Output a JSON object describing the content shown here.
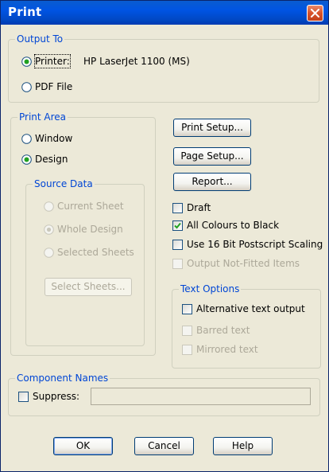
{
  "window": {
    "title": "Print"
  },
  "output_to": {
    "group_label": "Output To",
    "printer_label": "Printer:",
    "printer_name": "HP LaserJet 1100 (MS)",
    "pdf_label": "PDF File",
    "selected": "printer"
  },
  "print_area": {
    "group_label": "Print Area",
    "window_label": "Window",
    "design_label": "Design",
    "selected": "design",
    "source_data": {
      "group_label": "Source Data",
      "current_sheet_label": "Current Sheet",
      "whole_design_label": "Whole Design",
      "selected_sheets_label": "Selected Sheets",
      "select_sheets_button": "Select Sheets...",
      "selected": "whole_design"
    }
  },
  "buttons": {
    "print_setup": "Print Setup...",
    "page_setup": "Page Setup...",
    "report": "Report..."
  },
  "options": {
    "draft": "Draft",
    "all_colours_to_black": "All Colours to Black",
    "use_16bit_postscript": "Use 16 Bit Postscript Scaling",
    "output_not_fitted": "Output Not-Fitted Items",
    "draft_checked": false,
    "all_colours_checked": true,
    "use_16bit_checked": false,
    "output_not_fitted_checked": false
  },
  "text_options": {
    "group_label": "Text Options",
    "alternative_text_output": "Alternative text output",
    "barred_text": "Barred text",
    "mirrored_text": "Mirrored text"
  },
  "component_names": {
    "group_label": "Component Names",
    "suppress_label": "Suppress:",
    "suppress_value": ""
  },
  "footer": {
    "ok": "OK",
    "cancel": "Cancel",
    "help": "Help"
  }
}
